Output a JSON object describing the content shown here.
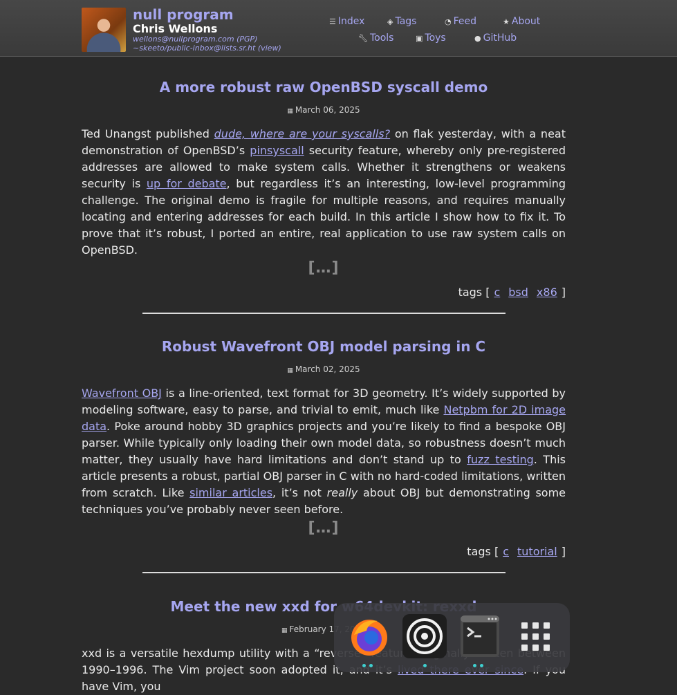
{
  "site": {
    "title": "null program",
    "author": "Chris Wellons",
    "email": "wellons@nullprogram.com",
    "pgp": "(PGP)",
    "inbox": "~skeeto/public-inbox@lists.sr.ht",
    "view": "(view)"
  },
  "nav": {
    "index": "Index",
    "tags": "Tags",
    "feed": "Feed",
    "about": "About",
    "tools": "Tools",
    "toys": "Toys",
    "github": "GitHub"
  },
  "articles": [
    {
      "title": "A more robust raw OpenBSD syscall demo",
      "date": "March 06, 2025",
      "p1_a": "Ted Unangst published ",
      "link1": "dude, where are your syscalls?",
      "p1_b": " on flak yesterday, with a neat demonstration of OpenBSD’s ",
      "link2": "pinsyscall",
      "p1_c": " security feature, whereby only pre-registered addresses are allowed to make system calls. Whether it strengthens or weakens security is ",
      "link3": "up for debate",
      "p1_d": ", but regardless it’s an interesting, low-level programming challenge. The original demo is fragile for multiple reasons, and requires manually locating and entering addresses for each build. In this article I show how to fix it. To prove that it’s robust, I ported an entire, real application to use raw system calls on OpenBSD.",
      "more": "[…]",
      "tags_open": "tags [",
      "tags": [
        "c",
        "bsd",
        "x86"
      ],
      "tags_close": "]"
    },
    {
      "title": "Robust Wavefront OBJ model parsing in C",
      "date": "March 02, 2025",
      "link1": "Wavefront OBJ",
      "p1_a": " is a line-oriented, text format for 3D geometry. It’s widely supported by modeling software, easy to parse, and trivial to emit, much like ",
      "link2": "Netpbm for 2D image data",
      "p1_b": ". Poke around hobby 3D graphics projects and you’re likely to find a bespoke OBJ parser. While typically only loading their own model data, so robustness doesn’t much matter, they usually have hard limitations and don’t stand up to ",
      "link3": "fuzz testing",
      "p1_c": ". This article presents a robust, partial OBJ parser in C with no hard-coded limitations, written from scratch. Like ",
      "link4": "similar articles",
      "p1_d": ", it’s not ",
      "em": "really",
      "p1_e": " about OBJ but demonstrating some techniques you’ve probably never seen before.",
      "more": "[…]",
      "tags_open": "tags [",
      "tags": [
        "c",
        "tutorial"
      ],
      "tags_close": "]"
    },
    {
      "title": "Meet the new xxd for w64devkit: rexxd",
      "date": "February 17, 2025",
      "p1_a": "xxd is a versatile hexdump utility with a “reverse” feature, originally written between 1990–1996. The Vim project soon adopted it, and it’s ",
      "link1": "lived there ever since",
      "p1_b": ". If you have Vim, you"
    }
  ],
  "dock": {
    "items": [
      "firefox-icon",
      "obs-icon",
      "terminal-icon",
      "app-grid-icon"
    ],
    "accent": "#3fd0d0"
  }
}
